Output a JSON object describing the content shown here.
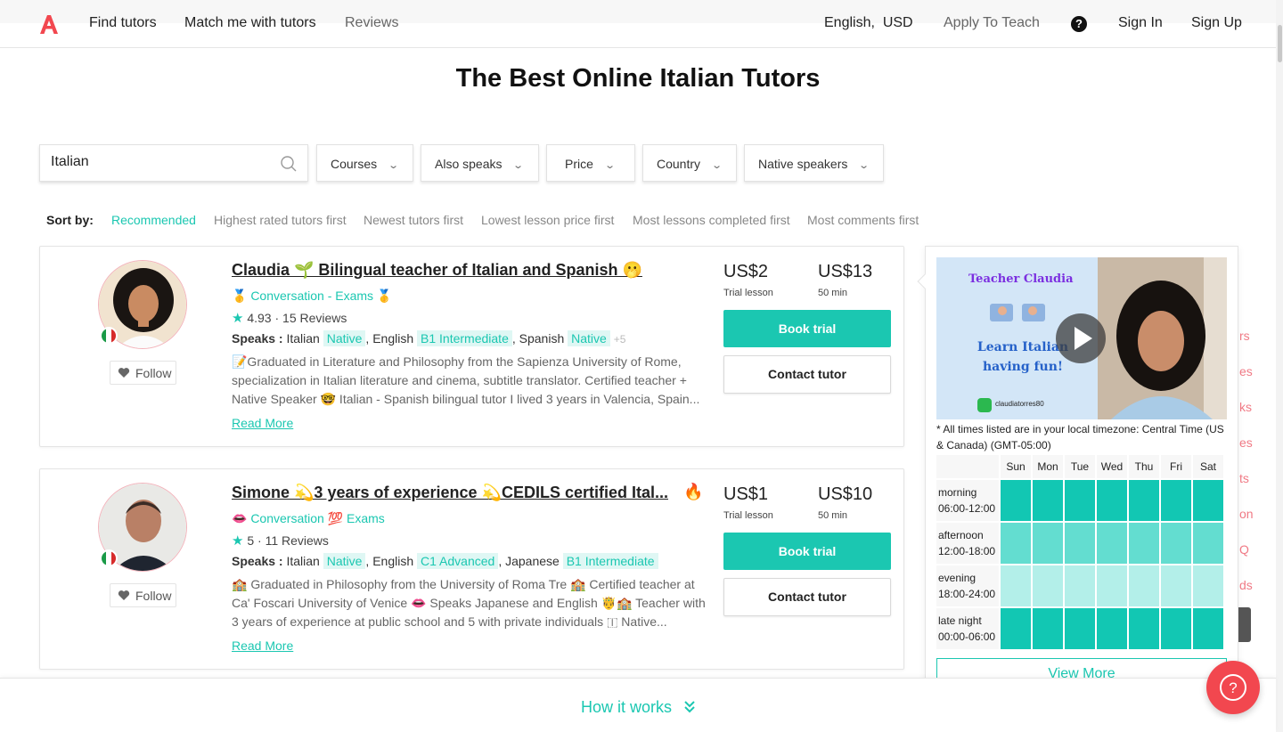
{
  "header": {
    "nav": [
      "Find tutors",
      "Match me with tutors",
      "Reviews"
    ],
    "language": "English",
    "currency": "USD",
    "apply": "Apply To Teach",
    "sign_in": "Sign In",
    "sign_up": "Sign Up",
    "help_glyph": "?"
  },
  "page_title": "The Best Online Italian Tutors",
  "search": {
    "value": "Italian",
    "placeholder": ""
  },
  "filters": [
    "Courses",
    "Also speaks",
    "Price",
    "Country",
    "Native speakers"
  ],
  "sort": {
    "label": "Sort by:",
    "options": [
      "Recommended",
      "Highest rated tutors first",
      "Newest tutors first",
      "Lowest lesson price first",
      "Most lessons completed first",
      "Most comments first"
    ],
    "active": "Recommended"
  },
  "tutors": [
    {
      "name": "Claudia 🌱 Bilingual teacher of Italian and Spanish 🫢",
      "tags": "🥇 Conversation - Exams 🥇",
      "rating": "4.93",
      "reviews": "15 Reviews",
      "speaks_label": "Speaks :",
      "languages": [
        {
          "lang": "Italian",
          "level": "Native"
        },
        {
          "lang": "English",
          "level": "B1 Intermediate"
        },
        {
          "lang": "Spanish",
          "level": "Native"
        }
      ],
      "more_languages": "+5",
      "description": "📝Graduated in Literature and Philosophy from the Sapienza University of Rome, specialization in Italian literature and cinema, subtitle translator. Certified teacher + Native Speaker 🤓 Italian - Spanish bilingual tutor I lived 3 years in Valencia, Spain...",
      "read_more": "Read More",
      "follow": "Follow",
      "trial_price": "US$2",
      "trial_label": "Trial lesson",
      "price": "US$13",
      "price_label": "50 min",
      "book": "Book trial",
      "contact": "Contact tutor"
    },
    {
      "name": "Simone 💫3 years of experience 💫CEDILS certified Ital...",
      "name_badge": "🔥",
      "tags": "👄 Conversation 💯 Exams",
      "rating": "5",
      "reviews": "11 Reviews",
      "speaks_label": "Speaks :",
      "languages": [
        {
          "lang": "Italian",
          "level": "Native"
        },
        {
          "lang": "English",
          "level": "C1 Advanced"
        },
        {
          "lang": "Japanese",
          "level": "B1 Intermediate"
        }
      ],
      "description": "🏫 Graduated in Philosophy from the University of Roma Tre 🏫 Certified teacher at Ca' Foscari University of Venice 👄 Speaks Japanese and English 🤴🏫 Teacher with 3 years of experience at public school and 5 with private individuals 🇮 Native...",
      "read_more": "Read More",
      "follow": "Follow",
      "trial_price": "US$1",
      "trial_label": "Trial lesson",
      "price": "US$10",
      "price_label": "50 min",
      "book": "Book trial",
      "contact": "Contact tutor"
    }
  ],
  "preview": {
    "video_title": "Teacher Claudia",
    "video_line1": "Learn Italian",
    "video_line2": "having fun!",
    "video_handle": "claudiatorres80",
    "timezone_note": "* All times listed are in your local timezone: Central Time (US & Canada) (GMT-05:00)",
    "days": [
      "Sun",
      "Mon",
      "Tue",
      "Wed",
      "Thu",
      "Fri",
      "Sat"
    ],
    "slots": [
      {
        "name": "morning",
        "range": "06:00-12:00",
        "color": "#12c7b3"
      },
      {
        "name": "afternoon",
        "range": "12:00-18:00",
        "color": "#63ddd0"
      },
      {
        "name": "evening",
        "range": "18:00-24:00",
        "color": "#b3efe9"
      },
      {
        "name": "late night",
        "range": "00:00-06:00",
        "color": "#12c7b3"
      }
    ],
    "view_more": "View More"
  },
  "side_peek": [
    "rs",
    "es",
    "ks",
    "es",
    "ts",
    "on",
    "Q",
    "ds"
  ],
  "bottom": {
    "how_it_works": "How it works"
  },
  "colors": {
    "accent": "#1bc7b1",
    "brand": "#f2474f"
  }
}
